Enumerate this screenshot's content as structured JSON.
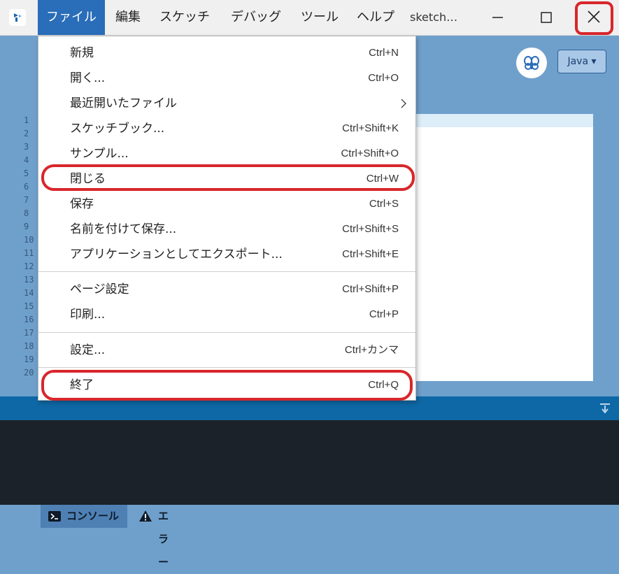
{
  "menubar": {
    "items": [
      {
        "label": "ファイル",
        "active": true
      },
      {
        "label": "編集"
      },
      {
        "label": "スケッチ"
      },
      {
        "label": "デバッグ"
      },
      {
        "label": "ツール"
      },
      {
        "label": "ヘルプ"
      }
    ],
    "window_title": "sketch…"
  },
  "toolbar": {
    "mode": "Java ▾",
    "debug_icon": "butterfly-icon"
  },
  "editor": {
    "line_numbers": [
      "1",
      "2",
      "3",
      "4",
      "5",
      "6",
      "7",
      "8",
      "9",
      "10",
      "11",
      "12",
      "13",
      "14",
      "15",
      "16",
      "17",
      "18",
      "19",
      "20"
    ]
  },
  "file_menu": {
    "items": [
      {
        "label": "新規",
        "shortcut": "Ctrl+N"
      },
      {
        "label": "開く...",
        "shortcut": "Ctrl+O"
      },
      {
        "label": "最近開いたファイル",
        "shortcut": "",
        "submenu": true
      },
      {
        "label": "スケッチブック...",
        "shortcut": "Ctrl+Shift+K"
      },
      {
        "label": "サンプル...",
        "shortcut": "Ctrl+Shift+O"
      },
      {
        "label": "閉じる",
        "shortcut": "Ctrl+W"
      },
      {
        "label": "保存",
        "shortcut": "Ctrl+S"
      },
      {
        "label": "名前を付けて保存...",
        "shortcut": "Ctrl+Shift+S"
      },
      {
        "label": "アプリケーションとしてエクスポート...",
        "shortcut": "Ctrl+Shift+E"
      },
      {
        "label": "ページ設定",
        "shortcut": "Ctrl+Shift+P"
      },
      {
        "label": "印刷...",
        "shortcut": "Ctrl+P"
      },
      {
        "label": "設定...",
        "shortcut": "Ctrl+カンマ"
      },
      {
        "label": "終了",
        "shortcut": "Ctrl+Q"
      }
    ]
  },
  "console_tabs": {
    "console": "コンソール",
    "error": "エラー"
  },
  "colors": {
    "highlight": "#d8262b",
    "active_menu": "#2a6db8"
  }
}
